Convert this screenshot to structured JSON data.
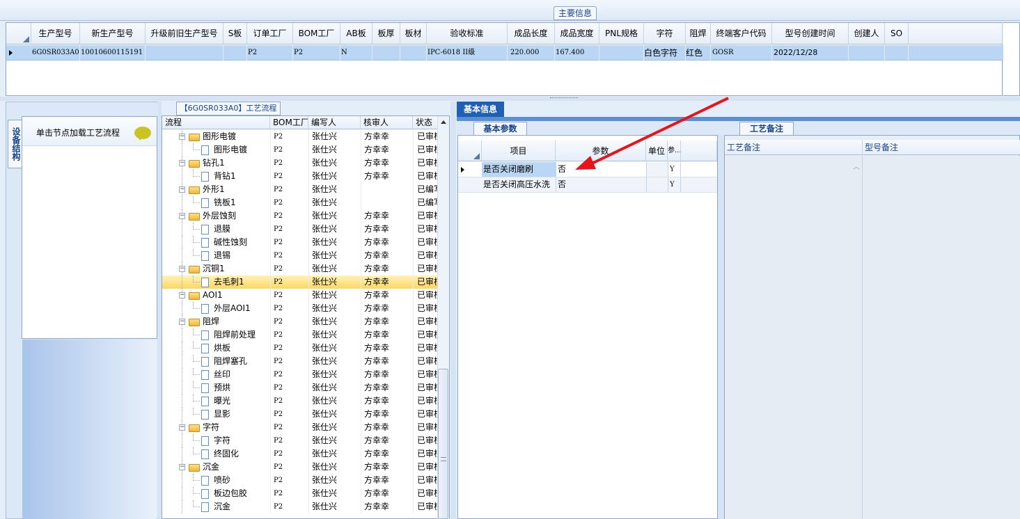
{
  "main_info": {
    "title": "主要信息",
    "columns": [
      "生产型号",
      "新生产型号",
      "升级前旧生产型号",
      "S板",
      "订单工厂",
      "BOM工厂",
      "AB板",
      "板厚",
      "板材",
      "验收标准",
      "成品长度",
      "成品宽度",
      "PNL规格",
      "字符",
      "阻焊",
      "终端客户代码",
      "型号创建时间",
      "创建人",
      "SO"
    ],
    "row": {
      "production_model": "6G0SR033A0",
      "new_model": "10010600115191",
      "old_model": "",
      "s_board": "",
      "order_factory": "P2",
      "bom_factory": "P2",
      "ab_board": "N",
      "thickness": "",
      "material": "",
      "acceptance": "IPC-6018 II级",
      "length": "220.000",
      "width": "167.400",
      "pnl": "",
      "character": "白色字符",
      "solder_mask": "红色",
      "customer_code": "GOSR",
      "created_time": "2022/12/28",
      "creator": "",
      "so": ""
    }
  },
  "left_panel": {
    "vertical_tab": "设备结构",
    "node_hint": "单击节点加载工艺流程"
  },
  "process_tree": {
    "title": "【6G0SR033A0】工艺流程",
    "columns": [
      "流程",
      "BOM工厂",
      "编写人",
      "核审人",
      "状态"
    ],
    "rows": [
      {
        "level": 1,
        "name": "图形电镀",
        "bom": "P2",
        "writer": "张仕兴",
        "reviewer": "方幸幸",
        "status": "已审核"
      },
      {
        "level": 2,
        "name": "图形电镀",
        "bom": "P2",
        "writer": "张仕兴",
        "reviewer": "方幸幸",
        "status": "已审核"
      },
      {
        "level": 1,
        "name": "钻孔1",
        "bom": "P2",
        "writer": "张仕兴",
        "reviewer": "方幸幸",
        "status": "已审核"
      },
      {
        "level": 2,
        "name": "背钻1",
        "bom": "P2",
        "writer": "张仕兴",
        "reviewer": "方幸幸",
        "status": "已审核"
      },
      {
        "level": 1,
        "name": "外形1",
        "bom": "P2",
        "writer": "张仕兴",
        "reviewer": "",
        "status": "已编写"
      },
      {
        "level": 2,
        "name": "铣板1",
        "bom": "P2",
        "writer": "张仕兴",
        "reviewer": "",
        "status": "已编写"
      },
      {
        "level": 1,
        "name": "外层蚀刻",
        "bom": "P2",
        "writer": "张仕兴",
        "reviewer": "方幸幸",
        "status": "已审核"
      },
      {
        "level": 2,
        "name": "退膜",
        "bom": "P2",
        "writer": "张仕兴",
        "reviewer": "方幸幸",
        "status": "已审核"
      },
      {
        "level": 2,
        "name": "碱性蚀刻",
        "bom": "P2",
        "writer": "张仕兴",
        "reviewer": "方幸幸",
        "status": "已审核"
      },
      {
        "level": 2,
        "name": "退锡",
        "bom": "P2",
        "writer": "张仕兴",
        "reviewer": "方幸幸",
        "status": "已审核"
      },
      {
        "level": 1,
        "name": "沉铜1",
        "bom": "P2",
        "writer": "张仕兴",
        "reviewer": "方幸幸",
        "status": "已审核"
      },
      {
        "level": 2,
        "name": "去毛刺1",
        "bom": "P2",
        "writer": "张仕兴",
        "reviewer": "方幸幸",
        "status": "已审核",
        "selected": true
      },
      {
        "level": 1,
        "name": "AOI1",
        "bom": "P2",
        "writer": "张仕兴",
        "reviewer": "方幸幸",
        "status": "已审核"
      },
      {
        "level": 2,
        "name": "外层AOI1",
        "bom": "P2",
        "writer": "张仕兴",
        "reviewer": "方幸幸",
        "status": "已审核"
      },
      {
        "level": 1,
        "name": "阻焊",
        "bom": "P2",
        "writer": "张仕兴",
        "reviewer": "方幸幸",
        "status": "已审核"
      },
      {
        "level": 2,
        "name": "阻焊前处理",
        "bom": "P2",
        "writer": "张仕兴",
        "reviewer": "方幸幸",
        "status": "已审核"
      },
      {
        "level": 2,
        "name": "烘板",
        "bom": "P2",
        "writer": "张仕兴",
        "reviewer": "方幸幸",
        "status": "已审核"
      },
      {
        "level": 2,
        "name": "阻焊塞孔",
        "bom": "P2",
        "writer": "张仕兴",
        "reviewer": "方幸幸",
        "status": "已审核"
      },
      {
        "level": 2,
        "name": "丝印",
        "bom": "P2",
        "writer": "张仕兴",
        "reviewer": "方幸幸",
        "status": "已审核"
      },
      {
        "level": 2,
        "name": "预烘",
        "bom": "P2",
        "writer": "张仕兴",
        "reviewer": "方幸幸",
        "status": "已审核"
      },
      {
        "level": 2,
        "name": "曝光",
        "bom": "P2",
        "writer": "张仕兴",
        "reviewer": "方幸幸",
        "status": "已审核"
      },
      {
        "level": 2,
        "name": "显影",
        "bom": "P2",
        "writer": "张仕兴",
        "reviewer": "方幸幸",
        "status": "已审核"
      },
      {
        "level": 1,
        "name": "字符",
        "bom": "P2",
        "writer": "张仕兴",
        "reviewer": "方幸幸",
        "status": "已审核"
      },
      {
        "level": 2,
        "name": "字符",
        "bom": "P2",
        "writer": "张仕兴",
        "reviewer": "方幸幸",
        "status": "已审核"
      },
      {
        "level": 2,
        "name": "终固化",
        "bom": "P2",
        "writer": "张仕兴",
        "reviewer": "方幸幸",
        "status": "已审核"
      },
      {
        "level": 1,
        "name": "沉金",
        "bom": "P2",
        "writer": "张仕兴",
        "reviewer": "方幸幸",
        "status": "已审核"
      },
      {
        "level": 2,
        "name": "喷砂",
        "bom": "P2",
        "writer": "张仕兴",
        "reviewer": "方幸幸",
        "status": "已审核"
      },
      {
        "level": 2,
        "name": "板边包胶",
        "bom": "P2",
        "writer": "张仕兴",
        "reviewer": "方幸幸",
        "status": "已审核"
      },
      {
        "level": 2,
        "name": "沉金",
        "bom": "P2",
        "writer": "张仕兴",
        "reviewer": "方幸幸",
        "status": "已审核"
      }
    ]
  },
  "basic_info": {
    "tab": "基本信息",
    "param_tab": "基本参数",
    "columns": [
      "项目",
      "参数",
      "单位",
      "参..."
    ],
    "rows": [
      {
        "item": "是否关闭磨刷",
        "value": "否",
        "unit": "",
        "flag": "Y",
        "current": true
      },
      {
        "item": "是否关闭高压水洗",
        "value": "否",
        "unit": "",
        "flag": "Y",
        "current": false
      }
    ]
  },
  "remarks": {
    "tab": "工艺备注",
    "columns": [
      "工艺备注",
      "型号备注"
    ]
  },
  "annotation": {
    "color": "#e8141b"
  },
  "colors": {
    "selected_row": "#b9d6f5",
    "tab_active": "#1f5fb4",
    "tree_selected": "#ffd760"
  }
}
